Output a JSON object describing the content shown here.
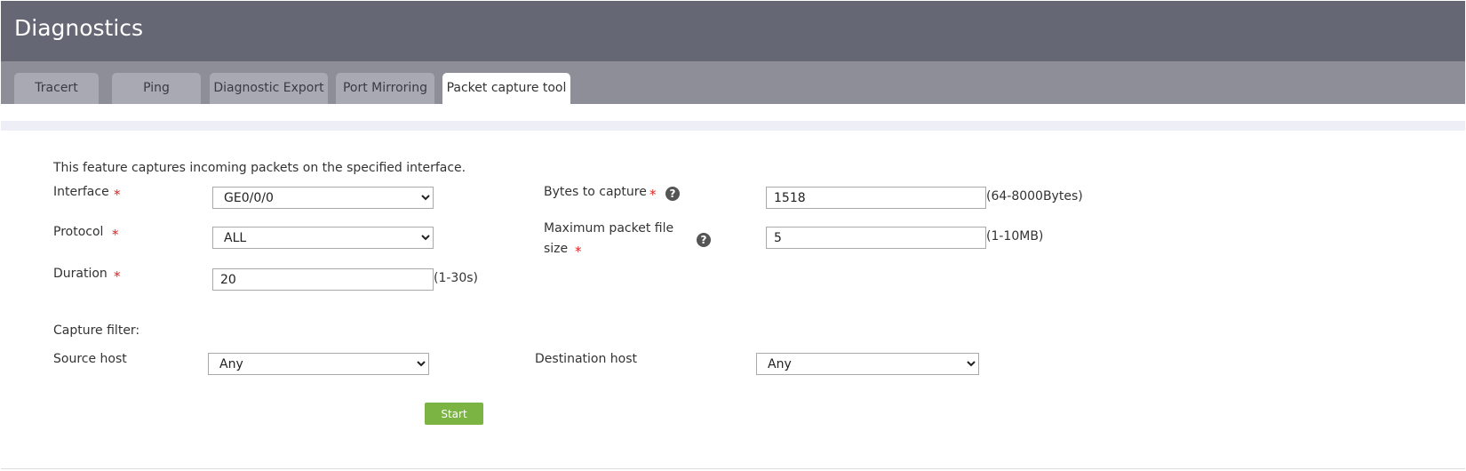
{
  "header": {
    "title": "Diagnostics"
  },
  "tabs": [
    {
      "label": "Tracert"
    },
    {
      "label": "Ping"
    },
    {
      "label": "Diagnostic Export"
    },
    {
      "label": "Port Mirroring"
    },
    {
      "label": "Packet capture tool",
      "active": true
    }
  ],
  "form": {
    "description": "This feature captures incoming packets on the specified interface.",
    "required_mark": "*",
    "help_glyph": "?",
    "interface": {
      "label": "Interface",
      "value": "GE0/0/0"
    },
    "protocol": {
      "label": "Protocol",
      "value": "ALL"
    },
    "duration": {
      "label": "Duration",
      "value": "20",
      "hint": "(1-30s)"
    },
    "bytes_to_capture": {
      "label": "Bytes to capture",
      "value": "1518",
      "hint": "(64-8000Bytes)"
    },
    "max_file_size": {
      "label_line1": "Maximum packet file",
      "label_line2": "size",
      "value": "5",
      "hint": "(1-10MB)"
    },
    "capture_filter": {
      "label": "Capture filter:"
    },
    "source_host": {
      "label": "Source host",
      "value": "Any"
    },
    "destination_host": {
      "label": "Destination host",
      "value": "Any"
    },
    "start_label": "Start"
  },
  "colors": {
    "header_bg": "#666774",
    "tabbar_bg": "#8e8e99",
    "tab_bg": "#a9a9b4",
    "accent_button": "#7bb443",
    "required": "#e02020"
  }
}
